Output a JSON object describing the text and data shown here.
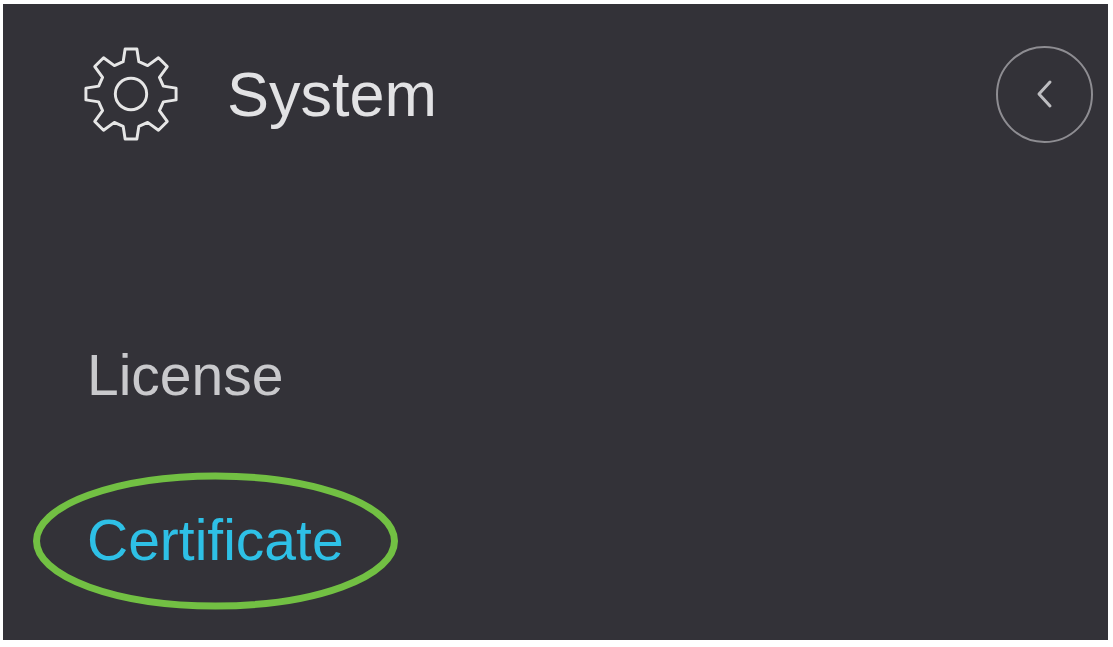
{
  "header": {
    "title": "System"
  },
  "nav_items": [
    {
      "label": "License",
      "selected": false,
      "highlighted": false
    },
    {
      "label": "Certificate",
      "selected": true,
      "highlighted": true
    }
  ]
}
